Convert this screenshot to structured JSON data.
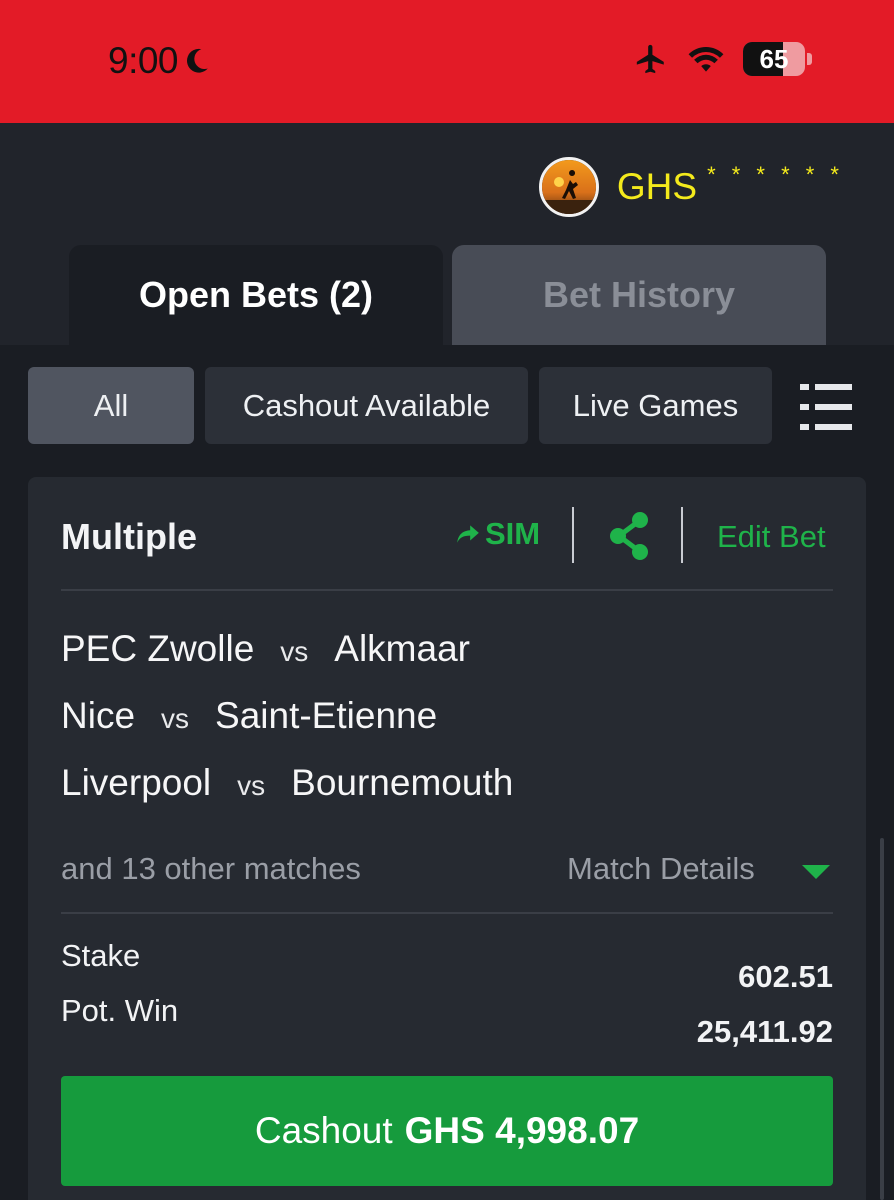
{
  "status_bar": {
    "time": "9:00",
    "battery": "65",
    "battery_fraction": 0.65,
    "icons": [
      "moon-icon",
      "airplane-icon",
      "wifi-icon",
      "battery-icon"
    ]
  },
  "account": {
    "currency": "GHS",
    "balance_masked": "* * * * * *"
  },
  "tabs": [
    {
      "label": "Open Bets (2)",
      "active": true
    },
    {
      "label": "Bet History",
      "active": false
    }
  ],
  "filters": [
    {
      "label": "All",
      "selected": true
    },
    {
      "label": "Cashout Available",
      "selected": false
    },
    {
      "label": "Live Games",
      "selected": false
    }
  ],
  "bet": {
    "type": "Multiple",
    "sim_label": "SIM",
    "edit_label": "Edit Bet",
    "matches": [
      {
        "home": "PEC Zwolle",
        "vs": "vs",
        "away": "Alkmaar"
      },
      {
        "home": "Nice",
        "vs": "vs",
        "away": "Saint-Etienne"
      },
      {
        "home": "Liverpool",
        "vs": "vs",
        "away": "Bournemouth"
      }
    ],
    "others_text": "and 13 other matches",
    "details_label": "Match Details",
    "stake_label": "Stake",
    "stake_value": "602.51",
    "potwin_label": "Pot. Win",
    "potwin_value": "25,411.92",
    "cashout_prefix": "Cashout",
    "cashout_amount": "GHS 4,998.07"
  },
  "colors": {
    "status_red": "#e31b27",
    "accent_green": "#1fb34a",
    "button_green": "#169b3d",
    "currency_yellow": "#f4ea1c"
  }
}
